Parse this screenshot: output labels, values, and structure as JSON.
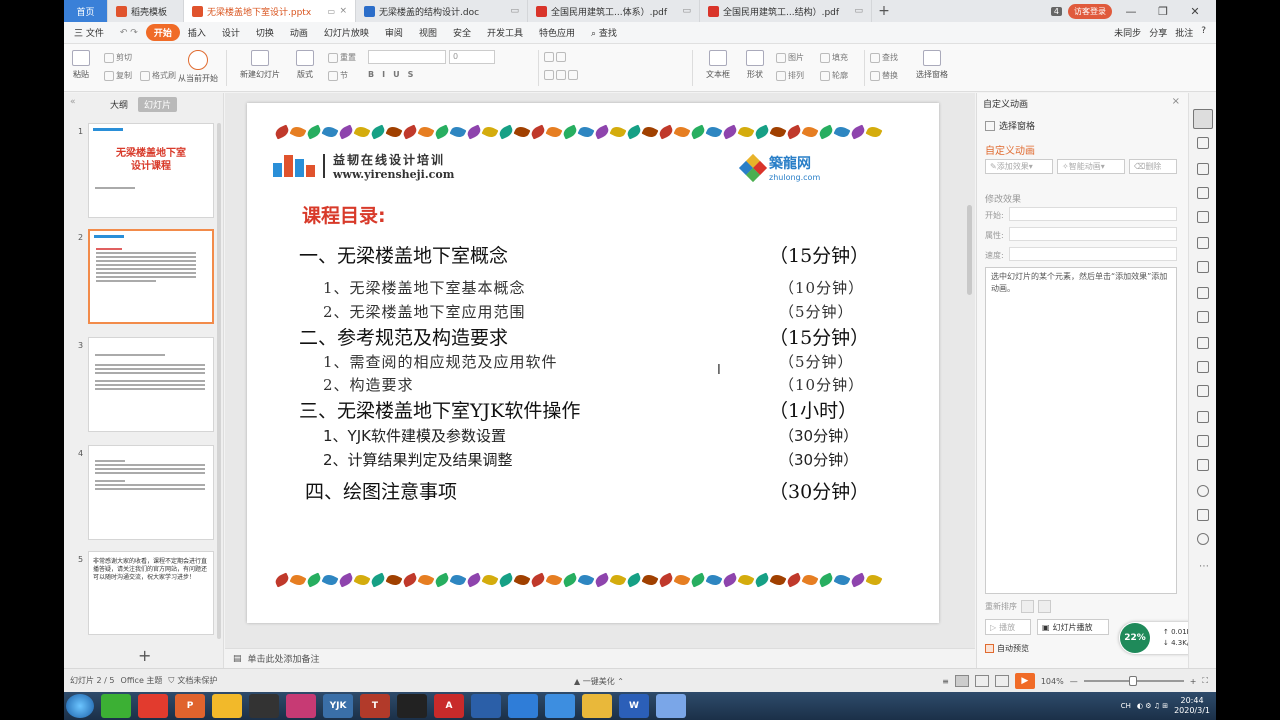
{
  "tabs": [
    {
      "label": "首页",
      "kind": "home"
    },
    {
      "label": "稻壳模板",
      "kind": "doc",
      "color": "#e0532d"
    },
    {
      "label": "无梁楼盖地下室设计.pptx",
      "kind": "doc",
      "color": "#e0532d",
      "active": true
    },
    {
      "label": "无梁楼盖的结构设计.doc",
      "kind": "doc",
      "color": "#2b6dc9"
    },
    {
      "label": "全国民用建筑工...体系）.pdf",
      "kind": "doc",
      "color": "#d9342a"
    },
    {
      "label": "全国民用建筑工...结构）.pdf",
      "kind": "doc",
      "color": "#d9342a"
    }
  ],
  "tab_count": "4",
  "visitor_label": "访客登录",
  "menu": [
    "三 文件",
    "开始",
    "插入",
    "设计",
    "切换",
    "动画",
    "幻灯片放映",
    "审阅",
    "视图",
    "安全",
    "开发工具",
    "特色应用",
    "查找"
  ],
  "menu_active": "开始",
  "menu_right": [
    "未同步",
    "分享",
    "批注",
    "?"
  ],
  "ribbon": {
    "paste": "粘贴",
    "cut": "剪切",
    "copy": "复制",
    "format_painter": "格式刷",
    "play_from_current": "从当前开始",
    "new_slide": "新建幻灯片",
    "layout": "版式",
    "section": "节",
    "reset": "重置",
    "font_size": "0",
    "textbox": "文本框",
    "shapes": "形状",
    "arrange": "排列",
    "picture": "图片",
    "fill": "填充",
    "outline": "轮廓",
    "find": "查找",
    "replace": "替换",
    "selection_pane": "选择窗格"
  },
  "left_panel": {
    "tab_outline": "大纲",
    "tab_slides": "幻灯片",
    "thumbnails": [
      {
        "num": "1",
        "title": "无梁楼盖地下室\n设计课程"
      },
      {
        "num": "2",
        "title": "课程目录"
      },
      {
        "num": "3",
        "title": ""
      },
      {
        "num": "4",
        "title": ""
      },
      {
        "num": "5",
        "title": "非常感谢大家的收看，课程不定期会进行直播答疑，请关注我们的官方网站，有问题还可以随时沟通交流，祝大家学习进步！"
      }
    ]
  },
  "slide": {
    "brand_cn": "益韧在线设计培训",
    "brand_url": "www.yirensheji.com",
    "zl_cn": "築龍网",
    "zl_url": "zhulong.com",
    "toc_title": "课程目录:",
    "rows": [
      {
        "label": "一、无梁楼盖地下室概念",
        "time": "（15分钟）",
        "level": 1
      },
      {
        "label": "1、无梁楼盖地下室基本概念",
        "time": "（10分钟）",
        "level": 2
      },
      {
        "label": "2、无梁楼盖地下室应用范围",
        "time": "（5分钟）",
        "level": 2
      },
      {
        "label": "二、参考规范及构造要求",
        "time": "（15分钟）",
        "level": 1
      },
      {
        "label": "1、需查阅的相应规范及应用软件",
        "time": "（5分钟）",
        "level": 2
      },
      {
        "label": "2、构造要求",
        "time": "（10分钟）",
        "level": 2
      },
      {
        "label": "三、无梁楼盖地下室YJK软件操作",
        "time": "（1小时）",
        "level": 1
      },
      {
        "label": "1、YJK软件建模及参数设置",
        "time": "（30分钟）",
        "level": 3
      },
      {
        "label": "2、计算结果判定及结果调整",
        "time": "（30分钟）",
        "level": 3
      },
      {
        "label": "四、绘图注意事项",
        "time": "（30分钟）",
        "level": 1
      }
    ]
  },
  "notes_placeholder": "单击此处添加备注",
  "right_pane": {
    "title": "自定义动画",
    "select_pane": "选择窗格",
    "custom_anim": "自定义动画",
    "add_effect": "添加效果",
    "smart_anim": "智能动画",
    "delete": "删除",
    "modify_effect": "修改效果",
    "start_label": "开始:",
    "property_label": "属性:",
    "speed_label": "速度:",
    "hint": "选中幻灯片的某个元素，然后单击“添加效果”添加动画。",
    "reorder": "重新排序",
    "play": "播放",
    "slideshow": "幻灯片播放",
    "autopreview": "自动预览"
  },
  "network": {
    "percent": "22%",
    "up": "0.01K/s",
    "down": "4.3K/s"
  },
  "status": {
    "slide_count": "幻灯片 2 / 5",
    "theme": "Office 主题",
    "protection": "文档未保护",
    "beautify": "一键美化",
    "zoom": "104%"
  },
  "taskbar_apps": [
    {
      "name": "wechat",
      "label": "",
      "color": "#3cb034"
    },
    {
      "name": "wps-writer",
      "label": "",
      "color": "#e23b2e"
    },
    {
      "name": "wps-presentation",
      "label": "P",
      "color": "#e0632d"
    },
    {
      "name": "chrome",
      "label": "",
      "color": "#f2b92a"
    },
    {
      "name": "autodesk",
      "label": "",
      "color": "#333333"
    },
    {
      "name": "wps-pdf",
      "label": "",
      "color": "#c73a74"
    },
    {
      "name": "yjk",
      "label": "YJK",
      "color": "#3a6fa8"
    },
    {
      "name": "tarch",
      "label": "T",
      "color": "#b23a2a"
    },
    {
      "name": "qq",
      "label": "",
      "color": "#222222"
    },
    {
      "name": "autocad",
      "label": "A",
      "color": "#c82a2a"
    },
    {
      "name": "tool",
      "label": "",
      "color": "#2b5fa8"
    },
    {
      "name": "feishu",
      "label": "",
      "color": "#2f7dd8"
    },
    {
      "name": "dingtalk",
      "label": "",
      "color": "#3d8ee0"
    },
    {
      "name": "explorer",
      "label": "",
      "color": "#e9b83a"
    },
    {
      "name": "wps-office",
      "label": "W",
      "color": "#2b5fb8"
    },
    {
      "name": "baidu-disk",
      "label": "",
      "color": "#7aa6e8"
    }
  ],
  "tray": {
    "lang": "CH",
    "time": "20:44",
    "date": "2020/3/1"
  }
}
